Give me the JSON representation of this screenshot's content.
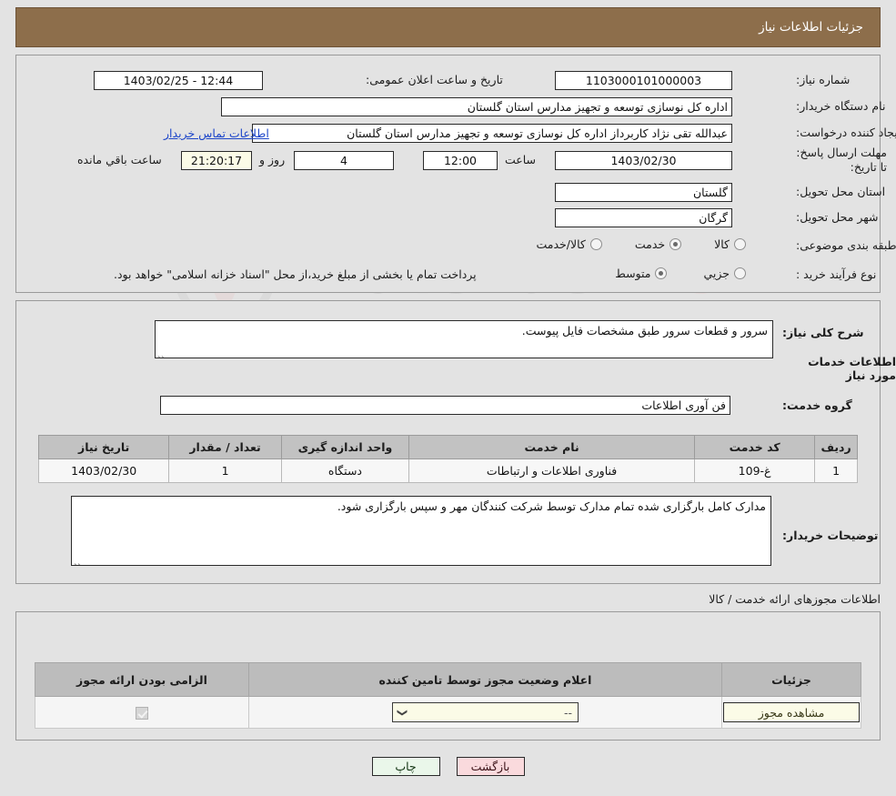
{
  "header": {
    "title": "جزئیات اطلاعات نیاز"
  },
  "top": {
    "need_number_label": "شماره نیاز:",
    "need_number_value": "1103000101000003",
    "announce_label": "تاریخ و ساعت اعلان عمومی:",
    "announce_value": "12:44 - 1403/02/25",
    "buyer_org_label": "نام دستگاه خریدار:",
    "buyer_org_value": "اداره کل نوسازی  توسعه و تجهیز مدارس استان گلستان",
    "creator_label": "ایجاد کننده درخواست:",
    "creator_value": "عبدالله تقی نژاد کاربرداز اداره کل نوسازی  توسعه و تجهیز مدارس استان گلستان",
    "contact_link": "اطلاعات تماس خریدار",
    "deadline_label": "مهلت ارسال پاسخ: تا تاریخ:",
    "deadline_date": "1403/02/30",
    "deadline_time_label": "ساعت",
    "deadline_time": "12:00",
    "days_value": "4",
    "days_label": "روز و",
    "countdown_value": "21:20:17",
    "countdown_label": "ساعت باقي مانده",
    "province_label": "استان محل تحویل:",
    "province_value": "گلستان",
    "city_label": "شهر محل تحویل:",
    "city_value": "گرگان",
    "category_label": "طبقه بندی موضوعی:",
    "category_options": [
      {
        "label": "کالا",
        "selected": false
      },
      {
        "label": "خدمت",
        "selected": true
      },
      {
        "label": "کالا/خدمت",
        "selected": false
      }
    ],
    "process_label": "نوع فرآیند خرید :",
    "process_options": [
      {
        "label": "جزیي",
        "selected": false
      },
      {
        "label": "متوسط",
        "selected": true
      }
    ],
    "payment_note": "پرداخت تمام یا بخشی از مبلغ خرید،از محل \"اسناد خزانه اسلامی\" خواهد بود."
  },
  "middle": {
    "summary_label": "شرح کلی نیاز:",
    "summary_value": "سرور و قطعات سرور طبق مشخصات فایل پیوست.",
    "services_heading": "اطلاعات خدمات مورد نیاز",
    "service_group_label": "گروه خدمت:",
    "service_group_value": "فن آوری اطلاعات",
    "table": {
      "headers": [
        "ردیف",
        "کد خدمت",
        "نام خدمت",
        "واحد اندازه گیری",
        "تعداد / مقدار",
        "تاریخ نیاز"
      ],
      "rows": [
        [
          "1",
          "غ-109",
          "فناوری اطلاعات و ارتباطات",
          "دستگاه",
          "1",
          "1403/02/30"
        ]
      ]
    },
    "buyer_notes_label": "توضیحات خریدار:",
    "buyer_notes_value": "مدارک کامل بارگزاری شده تمام مدارک توسط شرکت کنندگان مهر و سپس بارگزاری شود."
  },
  "licenses": {
    "section_label": "اطلاعات مجوزهای ارائه خدمت / کالا",
    "headers": [
      "الزامی بودن ارائه مجوز",
      "اعلام وضعیت مجوز توسط تامین کننده",
      "جزئیات"
    ],
    "row": {
      "required_checked": true,
      "status_value": "--",
      "details_button": "مشاهده مجوز"
    }
  },
  "footer": {
    "print_label": "چاپ",
    "back_label": "بازگشت"
  },
  "watermark": {
    "text_left": "AnaT",
    "text_right": "ender.net"
  }
}
